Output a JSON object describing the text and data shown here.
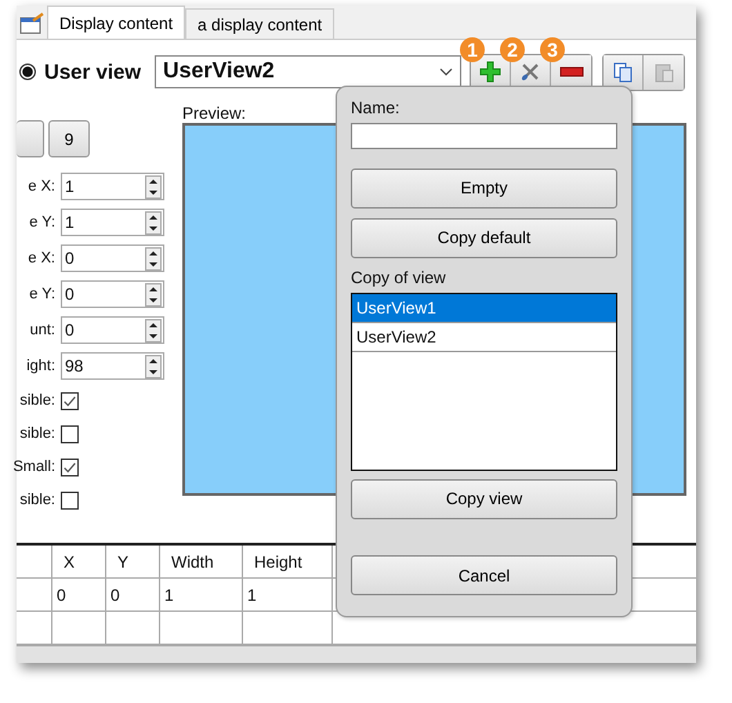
{
  "tabs": [
    {
      "label": "Display content",
      "selected": true
    },
    {
      "label": "a display content",
      "selected": false
    }
  ],
  "view_selector": {
    "label": "User view",
    "selected": true,
    "value": "UserView2"
  },
  "toolbar": [
    {
      "kind": "add",
      "badge": "1"
    },
    {
      "kind": "edit",
      "badge": "2"
    },
    {
      "kind": "remove",
      "badge": "3"
    },
    {
      "kind": "copy"
    },
    {
      "kind": "paste",
      "disabled": true
    }
  ],
  "preview_label": "Preview:",
  "page_buttons": [
    "9"
  ],
  "fields": [
    {
      "label": "e X:",
      "value": "1"
    },
    {
      "label": "e Y:",
      "value": "1"
    },
    {
      "label": "e X:",
      "value": "0"
    },
    {
      "label": "e Y:",
      "value": "0"
    },
    {
      "label": "unt:",
      "value": "0"
    },
    {
      "label": "ight:",
      "value": "98"
    }
  ],
  "checkboxes": [
    {
      "label": "sible:",
      "checked": true
    },
    {
      "label": "sible:",
      "checked": false
    },
    {
      "label": "Small:",
      "checked": true
    },
    {
      "label": "sible:",
      "checked": false
    }
  ],
  "table": {
    "columns": [
      "X",
      "Y",
      "Width",
      "Height"
    ],
    "rows": [
      [
        "0",
        "0",
        "1",
        "1"
      ]
    ]
  },
  "popup": {
    "name_label": "Name:",
    "buttons": [
      "Empty",
      "Copy default"
    ],
    "list_label": "Copy of view",
    "views": [
      {
        "label": "UserView1",
        "selected": true
      },
      {
        "label": "UserView2",
        "selected": false
      }
    ],
    "copy_button": "Copy view",
    "cancel_button": "Cancel"
  }
}
